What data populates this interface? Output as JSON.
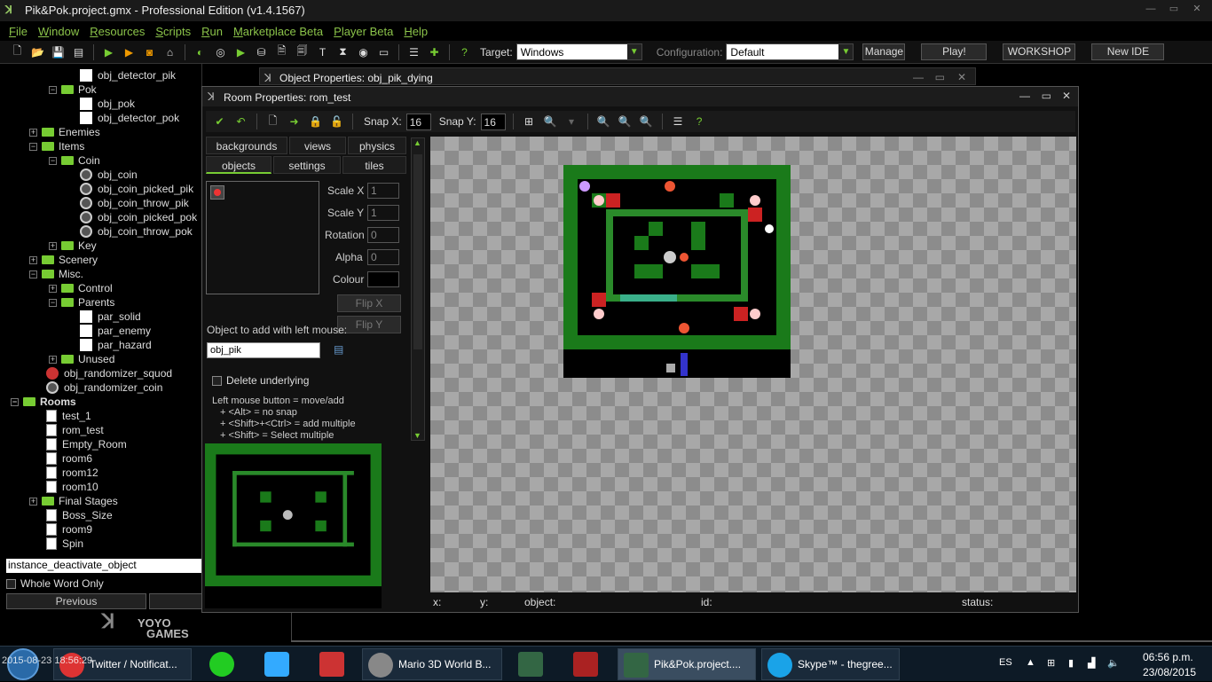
{
  "app": {
    "title": "Pik&Pok.project.gmx  -  Professional Edition (v1.4.1567)"
  },
  "menu": [
    "File",
    "Window",
    "Resources",
    "Scripts",
    "Run",
    "Marketplace Beta",
    "Player Beta",
    "Help"
  ],
  "toolbar": {
    "target_label": "Target:",
    "target_value": "Windows",
    "config_label": "Configuration:",
    "config_value": "Default",
    "manage": "Manage",
    "play": "Play!",
    "workshop": "WORKSHOP",
    "new_ide": "New IDE"
  },
  "tree": {
    "items": [
      {
        "label": "obj_detector_pik"
      },
      {
        "label": "Pok"
      },
      {
        "label": "obj_pok"
      },
      {
        "label": "obj_detector_pok"
      },
      {
        "label": "Enemies"
      },
      {
        "label": "Items"
      },
      {
        "label": "Coin"
      },
      {
        "label": "obj_coin"
      },
      {
        "label": "obj_coin_picked_pik"
      },
      {
        "label": "obj_coin_throw_pik"
      },
      {
        "label": "obj_coin_picked_pok"
      },
      {
        "label": "obj_coin_throw_pok"
      },
      {
        "label": "Key"
      },
      {
        "label": "Scenery"
      },
      {
        "label": "Misc."
      },
      {
        "label": "Control"
      },
      {
        "label": "Parents"
      },
      {
        "label": "par_solid"
      },
      {
        "label": "par_enemy"
      },
      {
        "label": "par_hazard"
      },
      {
        "label": "Unused"
      },
      {
        "label": "obj_randomizer_squod"
      },
      {
        "label": "obj_randomizer_coin"
      },
      {
        "label": "Rooms"
      },
      {
        "label": "test_1"
      },
      {
        "label": "rom_test"
      },
      {
        "label": "Empty_Room"
      },
      {
        "label": "room6"
      },
      {
        "label": "room12"
      },
      {
        "label": "room10"
      },
      {
        "label": "Final Stages"
      },
      {
        "label": "Boss_Size"
      },
      {
        "label": "room9"
      },
      {
        "label": "Spin"
      }
    ]
  },
  "search": {
    "value": "instance_deactivate_object",
    "whole_word": "Whole Word Only",
    "previous": "Previous"
  },
  "brand": {
    "line1": "YOYO",
    "line2": "GAMES"
  },
  "object_window": {
    "title": "Object Properties: obj_pik_dying"
  },
  "room": {
    "title": "Room Properties: rom_test",
    "snap_x_label": "Snap X:",
    "snap_x": "16",
    "snap_y_label": "Snap Y:",
    "snap_y": "16",
    "tabs": [
      "backgrounds",
      "views",
      "physics",
      "objects",
      "settings",
      "tiles"
    ],
    "scale_x_label": "Scale X",
    "scale_x": "1",
    "scale_y_label": "Scale Y",
    "scale_y": "1",
    "rotation_label": "Rotation",
    "rotation": "0",
    "alpha_label": "Alpha",
    "alpha": "0",
    "colour_label": "Colour",
    "flip_x": "Flip X",
    "flip_y": "Flip Y",
    "add_label": "Object to add with left mouse:",
    "add_value": "obj_pik",
    "delete_underlying": "Delete underlying",
    "help": [
      "Left mouse button = move/add",
      "+ <Alt> = no snap",
      "+ <Shift>+<Ctrl> = add multiple",
      "+ <Shift> = Select multiple"
    ],
    "status": {
      "x": "x:",
      "y": "y:",
      "object": "object:",
      "id": "id:",
      "status": "status:"
    }
  },
  "taskbar": {
    "items": [
      "Twitter / Notificat...",
      "Mario 3D World B...",
      "Pik&Pok.project....",
      "Skype™ - thegree..."
    ],
    "overlay": "2015-08-23 18:56:29",
    "lang": "ES",
    "time": "06:56 p.m.",
    "date": "23/08/2015"
  },
  "colors": {
    "accent": "#77cc33",
    "wall": "#1a7a1a",
    "dark": "#000000"
  }
}
